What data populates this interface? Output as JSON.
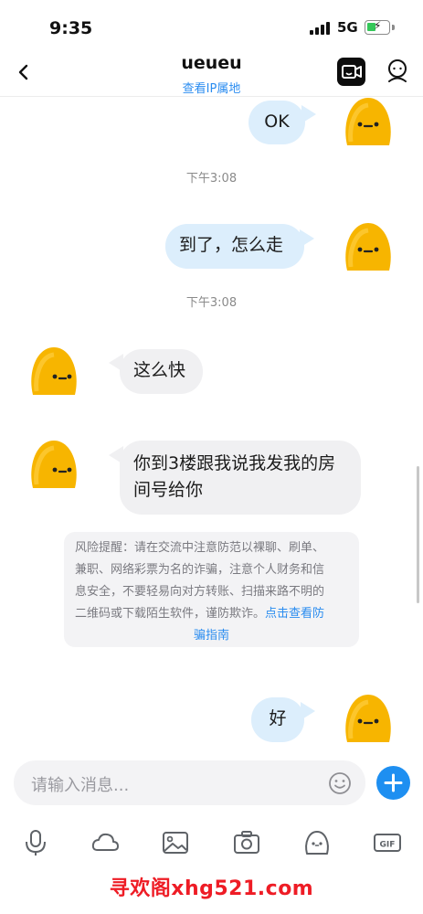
{
  "status_bar": {
    "time": "9:35",
    "network": "5G"
  },
  "header": {
    "title": "ueueu",
    "ip_link": "查看IP属地"
  },
  "messages": [
    {
      "direction": "out",
      "text": "OK"
    },
    {
      "timestamp": "下午3:08"
    },
    {
      "direction": "out",
      "text": "到了，怎么走"
    },
    {
      "timestamp": "下午3:08"
    },
    {
      "direction": "in",
      "text": "这么快"
    },
    {
      "direction": "in",
      "lines": [
        "你到3楼跟我说我发我的房",
        "间号给你"
      ]
    },
    {
      "direction": "out",
      "text": "好"
    }
  ],
  "risk_notice": {
    "lines": [
      "风险提醒：请在交流中注意防范以裸聊、刷单、",
      "兼职、网络彩票为名的诈骗，注意个人财务和信",
      "息安全，不要轻易向对方转账、扫描来路不明的",
      "二维码或下载陌生软件，谨防欺诈。"
    ],
    "link_part1": "点击查看防",
    "link_part2": "骗指南"
  },
  "input": {
    "placeholder": "请输入消息..."
  },
  "toolbar": {
    "icons": [
      "microphone-icon",
      "cloud-icon",
      "image-icon",
      "camera-icon",
      "sticker-icon",
      "gif-icon"
    ]
  },
  "watermark": "寻欢阁xhg521.com",
  "colors": {
    "accent": "#1e8ff1",
    "outgoing_bubble": "#dceefc",
    "incoming_bubble": "#f0f0f2",
    "avatar": "#f7b500",
    "watermark": "#ee1c25"
  }
}
